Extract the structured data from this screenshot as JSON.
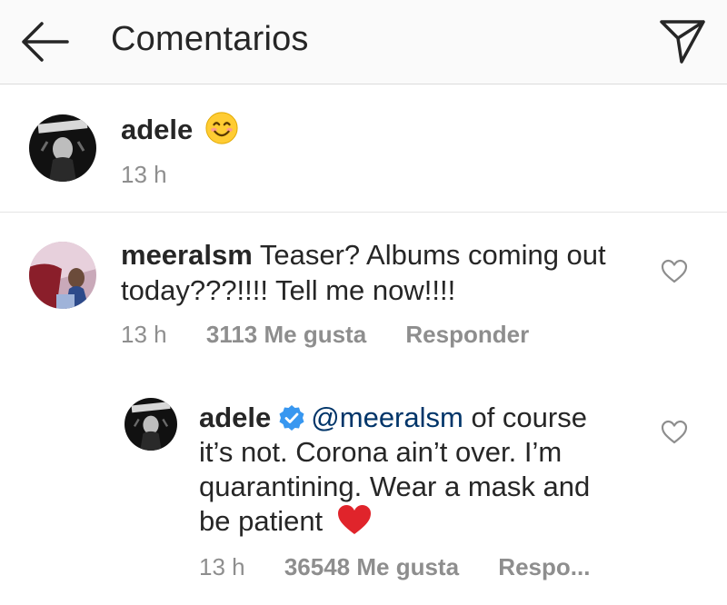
{
  "header": {
    "title": "Comentarios"
  },
  "caption": {
    "username": "adele",
    "time": "13 h"
  },
  "comment1": {
    "username": "meeralsm",
    "text_line1": "Teaser? Albums coming out",
    "text_line2": "today???!!!! Tell me now!!!!",
    "time": "13 h",
    "likes": "3113 Me gusta",
    "reply": "Responder"
  },
  "reply1": {
    "username": "adele",
    "mention": "@meeralsm",
    "text_line1_rest": "of course",
    "text_line2": "it’s not. Corona ain’t over. I’m",
    "text_line3": "quarantining. Wear a mask and",
    "text_line4": "be patient",
    "time": "13 h",
    "likes": "36548 Me gusta",
    "reply": "Respo..."
  },
  "colors": {
    "mention": "#003569",
    "verified": "#3897f0",
    "heart_emoji": "#e0242b",
    "muted": "#8e8e8e"
  },
  "icons": {
    "back": "arrow-left-icon",
    "send": "paper-plane-icon",
    "like": "heart-outline-icon",
    "verified": "verified-badge-icon"
  }
}
